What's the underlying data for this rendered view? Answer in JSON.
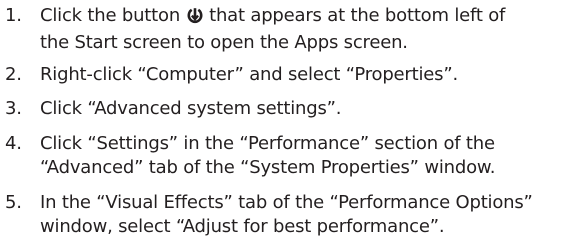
{
  "steps": [
    {
      "number": "1.",
      "line1_before_icon": "Click the button ",
      "icon": "down-arrow-circle-icon",
      "line1_after_icon": " that appears at the bottom left of",
      "line2": "the Start screen to open the Apps screen."
    },
    {
      "number": "2.",
      "line1": "Right-click “Computer” and select “Properties”."
    },
    {
      "number": "3.",
      "line1": "Click “Advanced system settings”."
    },
    {
      "number": "4.",
      "line1": "Click “Settings” in the “Performance” section of the",
      "line2": "“Advanced” tab of the “System Properties” window."
    },
    {
      "number": "5.",
      "line1": "In the “Visual Effects” tab of the “Performance Options”",
      "line2": "window, select “Adjust for best performance”."
    }
  ]
}
